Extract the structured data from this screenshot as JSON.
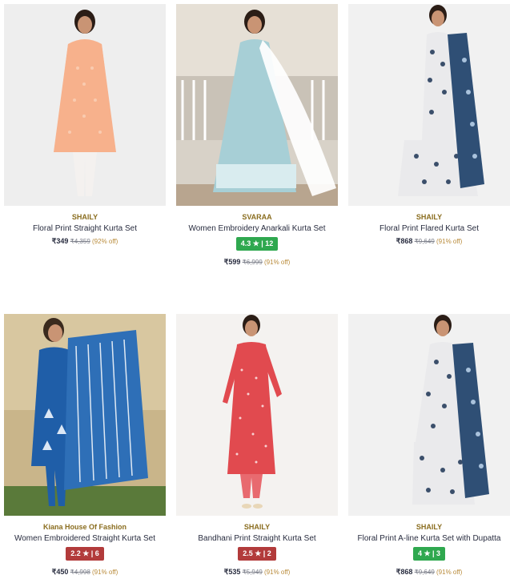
{
  "products": [
    {
      "brand": "SHAILY",
      "title": "Floral Print Straight Kurta Set",
      "rating": null,
      "price": "₹349",
      "mrp": "₹4,359",
      "discount": "(92% off)",
      "image_colors": {
        "bg": "#eeeeee",
        "garment": "#f7b18c",
        "bottom": "#f4f1ef"
      }
    },
    {
      "brand": "SVARAA",
      "title": "Women Embroidery Anarkali Kurta Set",
      "rating": "4.3 ★ | 12",
      "rating_color": "#2fa84f",
      "price": "₹599",
      "mrp": "₹6,999",
      "discount": "(91% off)",
      "image_colors": {
        "bg": "#d8d2c8",
        "garment": "#a7cfd6",
        "bottom": "#ffffff"
      }
    },
    {
      "brand": "SHAILY",
      "title": "Floral Print Flared Kurta Set",
      "rating": null,
      "price": "₹868",
      "mrp": "₹9,649",
      "discount": "(91% off)",
      "image_colors": {
        "bg": "#f1f1f1",
        "garment": "#eaeaec",
        "bottom": "#2f4f75"
      }
    },
    {
      "brand": "Kiana House Of Fashion",
      "title": "Women Embroidered Straight Kurta Set",
      "rating": "2.2 ★ | 6",
      "rating_color": "#b23b3b",
      "price": "₹450",
      "mrp": "₹4,998",
      "discount": "(91% off)",
      "image_colors": {
        "bg": "#c9b58a",
        "garment": "#1f5ea8",
        "bottom": "#5a7a3a"
      }
    },
    {
      "brand": "SHAILY",
      "title": "Bandhani Print Straight Kurta Set",
      "rating": "2.5 ★ | 2",
      "rating_color": "#b23b3b",
      "price": "₹535",
      "mrp": "₹5,949",
      "discount": "(91% off)",
      "image_colors": {
        "bg": "#f4f2f0",
        "garment": "#e14a4f",
        "bottom": "#e86a6f"
      }
    },
    {
      "brand": "SHAILY",
      "title": "Floral Print A-line Kurta Set with Dupatta",
      "rating": "4 ★ | 3",
      "rating_color": "#2fa84f",
      "price": "₹868",
      "mrp": "₹9,649",
      "discount": "(91% off)",
      "image_colors": {
        "bg": "#f1f1f1",
        "garment": "#eaeaec",
        "bottom": "#2f4f75"
      }
    }
  ]
}
